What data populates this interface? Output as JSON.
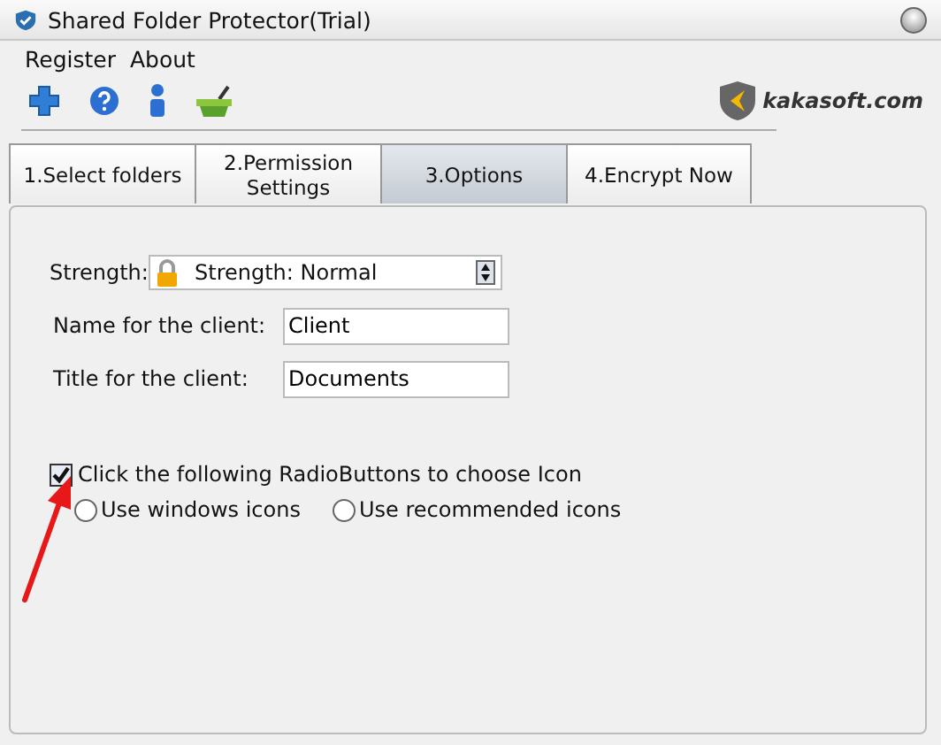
{
  "window": {
    "title": "Shared Folder Protector(Trial)"
  },
  "menu": [
    "Register",
    "About"
  ],
  "toolbar": [
    {
      "kind": "plus"
    },
    {
      "kind": "help"
    },
    {
      "kind": "info"
    },
    {
      "kind": "basket"
    }
  ],
  "brand": "kakasoft.com",
  "tabs": [
    {
      "label": "1.Select folders",
      "selected": false
    },
    {
      "label": "2.Permission Settings",
      "selected": false
    },
    {
      "label": "3.Options",
      "selected": true
    },
    {
      "label": "4.Encrypt Now",
      "selected": false
    }
  ],
  "options": {
    "strength_label": "Strength:",
    "strength_value": "Strength: Normal",
    "fields": [
      {
        "label": "Name for the client:",
        "value": "Client"
      },
      {
        "label": "Title for the client:",
        "value": "Documents"
      }
    ],
    "icon_choice": {
      "label": "Click the following RadioButtons to choose Icon",
      "checked": true
    },
    "radios": [
      {
        "label": "Use windows icons",
        "selected": false
      },
      {
        "label": "Use recommended icons",
        "selected": false
      }
    ]
  }
}
